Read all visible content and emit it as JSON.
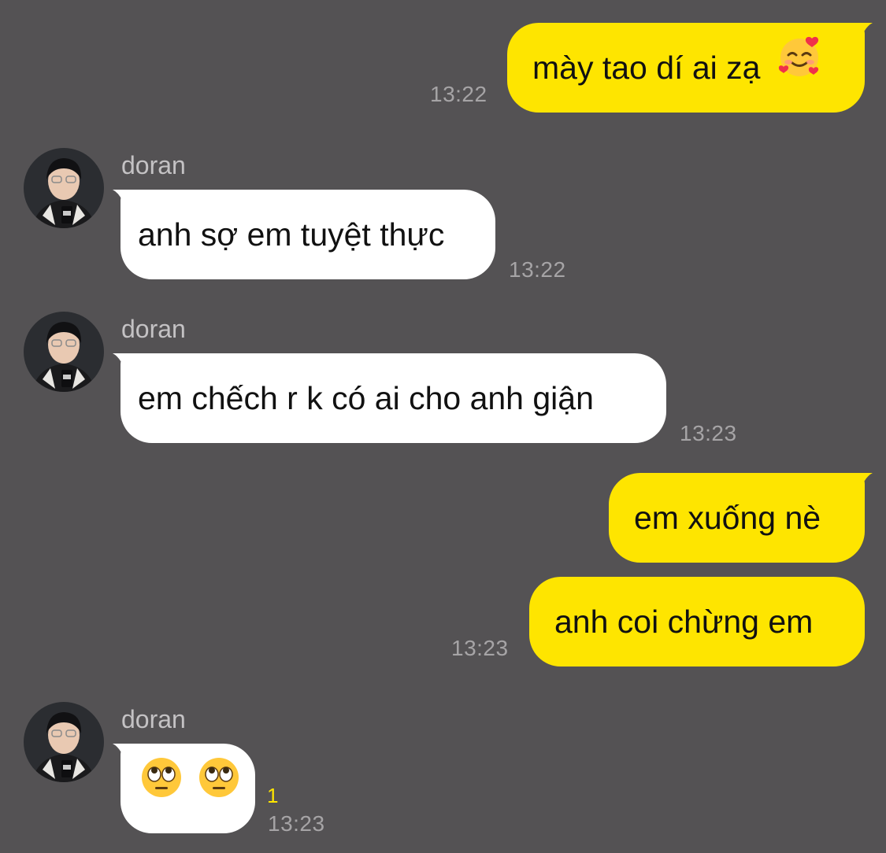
{
  "messages": [
    {
      "id": "m1",
      "sender": "me",
      "text": "mày tao dí ai zạ",
      "emoji": "smiling-face-with-hearts",
      "time": "13:22"
    },
    {
      "id": "m2",
      "sender": "doran",
      "name": "doran",
      "text": "anh sợ em tuyệt thực",
      "time": "13:22"
    },
    {
      "id": "m3",
      "sender": "doran",
      "name": "doran",
      "text": "em chếch r k có ai cho anh giận",
      "time": "13:23"
    },
    {
      "id": "m4",
      "sender": "me",
      "text": "em xuống nè"
    },
    {
      "id": "m5",
      "sender": "me",
      "text": "anh coi chừng em",
      "time": "13:23"
    },
    {
      "id": "m6",
      "sender": "doran",
      "name": "doran",
      "emojis": [
        "face-with-rolling-eyes",
        "face-with-rolling-eyes"
      ],
      "unread": "1",
      "time": "13:23"
    }
  ],
  "colors": {
    "background": "#545254",
    "my_bubble": "#FEE500",
    "their_bubble": "#FFFFFF",
    "timestamp": "#A6A4A6",
    "unread": "#FEE500"
  }
}
